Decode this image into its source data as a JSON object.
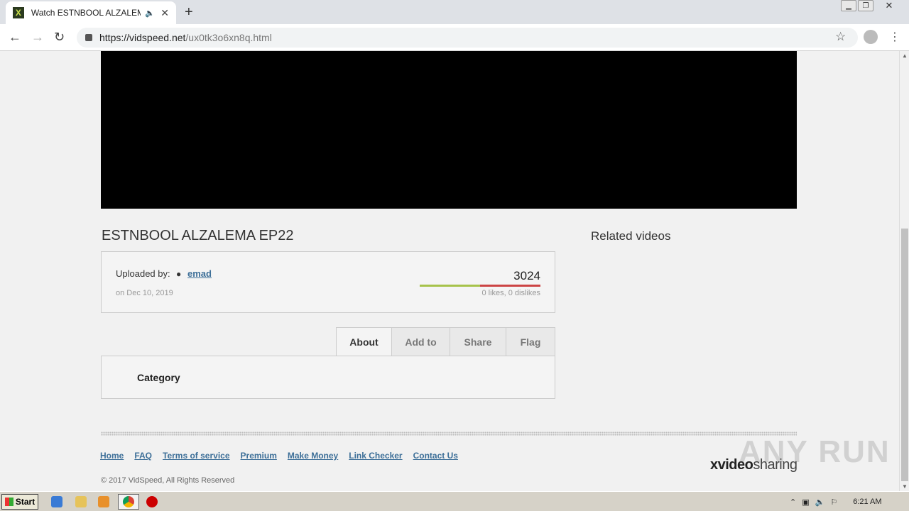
{
  "browser": {
    "tab_title": "Watch ESTNBOOL ALZALEMA EP22",
    "url_host": "https://vidspeed.net",
    "url_path": "/ux0tk3o6xn8q.html"
  },
  "video": {
    "title": "ESTNBOOL ALZALEMA EP22",
    "uploaded_label": "Uploaded by:",
    "uploader": "emad",
    "date": "on Dec 10, 2019",
    "views": "3024",
    "likes_text": "0 likes, 0 dislikes",
    "rating_fraction": 0.5
  },
  "tabs": [
    "About",
    "Add to",
    "Share",
    "Flag"
  ],
  "about": {
    "category_label": "Category"
  },
  "sidebar": {
    "related_title": "Related videos"
  },
  "footer": {
    "links": [
      "Home",
      "FAQ",
      "Terms of service",
      "Premium",
      "Make Money",
      "Link Checker",
      "Contact Us"
    ],
    "copyright": "© 2017 VidSpeed, All Rights Reserved",
    "brand_bold": "xvideo",
    "brand_rest": "sharing"
  },
  "watermark": "ANY RUN",
  "taskbar": {
    "start_label": "Start",
    "time": "6:21 AM"
  },
  "colors": {
    "link": "#3d6f98",
    "like_bar": "#a6c24a",
    "dislike_bar": "#cc4444"
  }
}
